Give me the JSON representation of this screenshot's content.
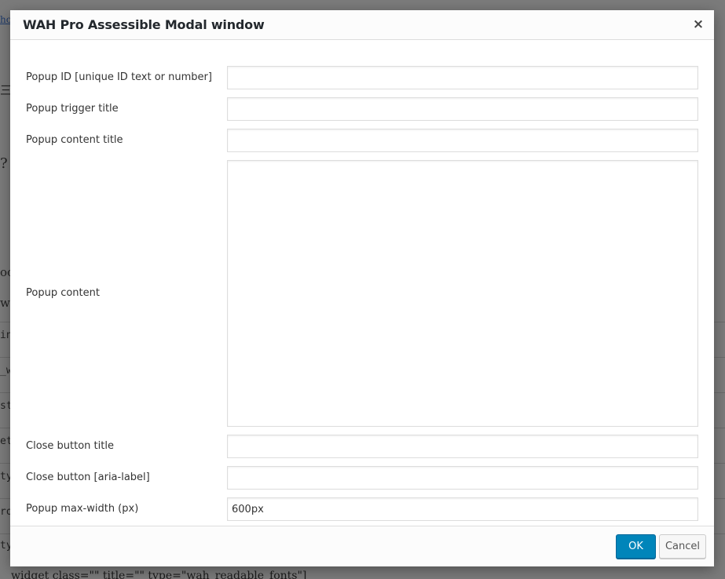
{
  "modal": {
    "title": "WAH Pro Assessible Modal window",
    "close_symbol": "×",
    "fields": {
      "popup_id": {
        "label": "Popup ID [unique ID text or number]",
        "value": ""
      },
      "trigger_title": {
        "label": "Popup trigger title",
        "value": ""
      },
      "content_title": {
        "label": "Popup content title",
        "value": ""
      },
      "content": {
        "label": "Popup content",
        "value": ""
      },
      "close_title": {
        "label": "Close button title",
        "value": ""
      },
      "close_aria": {
        "label": "Close button [aria-label]",
        "value": ""
      },
      "max_width": {
        "label": "Popup max-width (px)",
        "value": "600px"
      }
    },
    "buttons": {
      "ok": "OK",
      "cancel": "Cancel"
    }
  },
  "background": {
    "bottom_text": "widget class=\"\" title=\"\" type=\"wah_readable_fonts\"]",
    "left_fragments": [
      "ho",
      "三",
      "?",
      "oo",
      "wi",
      "in",
      "_w",
      "st",
      "et",
      "ty",
      "ro",
      "ty"
    ]
  },
  "colors": {
    "primary_button": "#0085ba",
    "overlay": "#7a7a7a",
    "border": "#dddddd"
  }
}
